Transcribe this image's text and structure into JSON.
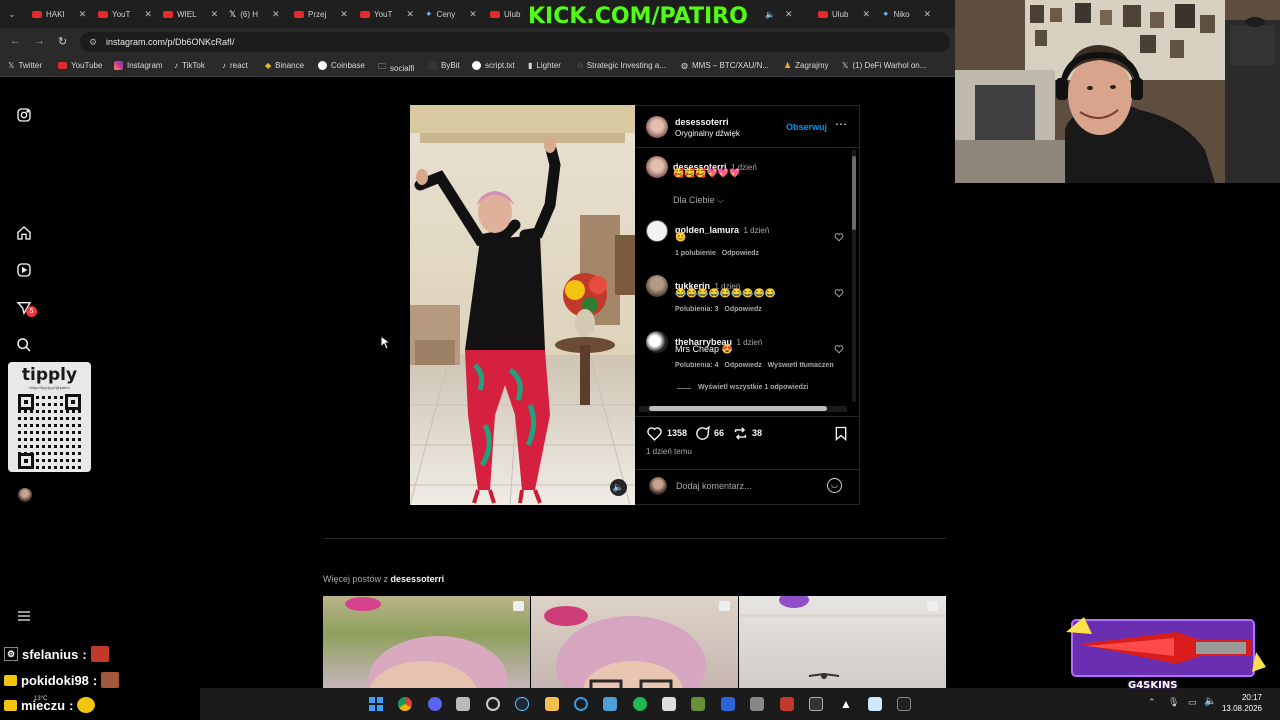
{
  "browser": {
    "tabs": [
      {
        "label": "HAKI",
        "icon": "youtube-icon"
      },
      {
        "label": "YouT",
        "icon": "youtube-icon"
      },
      {
        "label": "WIEL",
        "icon": "youtube-icon"
      },
      {
        "label": "(6) H",
        "icon": "x-icon"
      },
      {
        "label": "Przej",
        "icon": "youtube-icon"
      },
      {
        "label": "YouT",
        "icon": "youtube-icon"
      },
      {
        "label": "Ceny",
        "icon": "star-icon"
      },
      {
        "label": "Ulub",
        "icon": "youtube-icon"
      },
      {
        "label": "Ulub",
        "icon": "youtube-icon"
      },
      {
        "label": "Niko",
        "icon": "star-icon"
      }
    ],
    "stream_overlay": "KICK.COM/PATIRO",
    "url": "instagram.com/p/Db6ONKcRafI/",
    "bookmarks": [
      "Twitter",
      "YouTube",
      "Instagram",
      "TikTok",
      "react",
      "Binance",
      "Coinbase",
      "socialfi",
      "ByBit",
      "script.txt",
      "Lighter",
      "Strategic Investing a...",
      "MMS – BTC/XAU/N...",
      "Zagrajmy",
      "(1) DeFi Warhol on..."
    ]
  },
  "sidebar": {
    "notification_count": "5",
    "tipply": {
      "logo": "tipply",
      "sub": "https://tipply.pl/@patiro"
    }
  },
  "post": {
    "author": "desessoterri",
    "audio": "Oryginalny dźwięk",
    "follow_label": "Obserwuj",
    "caption_user": "desessoterri",
    "caption_time": "1 dzień",
    "caption_text": "🥰🥰🥰💖💖💖",
    "filter_label": "Dla Ciebie",
    "comments": [
      {
        "user": "golden_lamura",
        "time": "1 dzień",
        "text": "😊",
        "likes": "1 polubienie",
        "reply": "Odpowiedz",
        "translate": ""
      },
      {
        "user": "tukkerin",
        "time": "1 dzień",
        "text": "😂😂😂😂😂😂😂😂😂",
        "likes": "Polubienia: 3",
        "reply": "Odpowiedz",
        "translate": ""
      },
      {
        "user": "theharrybeau",
        "time": "1 dzień",
        "text": "Mrs Cheap 😍",
        "likes": "Polubienia: 4",
        "reply": "Odpowiedz",
        "translate": "Wyświetl tłumaczen"
      }
    ],
    "view_replies": "Wyświetl wszystkie 1 odpowiedzi",
    "like_count": "1358",
    "comment_count": "66",
    "repost_count": "38",
    "posted": "1 dzień temu",
    "add_comment_placeholder": "Dodaj komentarz..."
  },
  "more_posts": {
    "prefix": "Więcej postów z",
    "user": "desessoterri"
  },
  "chat": [
    {
      "user": "sfelanius",
      "sep": ":"
    },
    {
      "user": "pokidoki98",
      "sep": ":"
    },
    {
      "user": "mieczu",
      "sep": ":"
    }
  ],
  "skins_overlay": {
    "label": "G4SKINS"
  },
  "taskbar": {
    "time": "20:17",
    "date": "13.08.2026",
    "weather": "13°C"
  },
  "colors": {
    "instagram_blue": "#0095f6",
    "kick_green": "#53fc18",
    "notification_red": "#ff3040"
  }
}
